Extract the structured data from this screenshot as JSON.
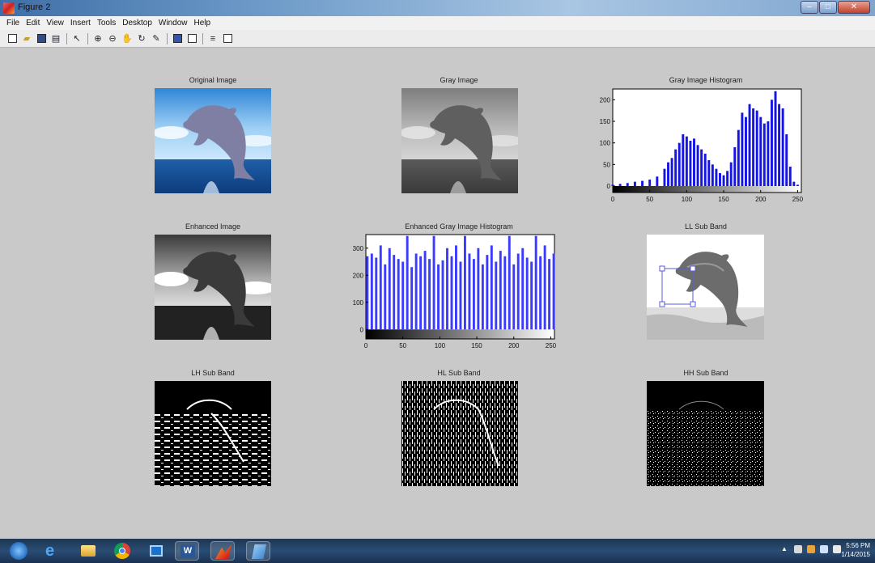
{
  "window": {
    "title": "Figure 2"
  },
  "menu": [
    "File",
    "Edit",
    "View",
    "Insert",
    "Tools",
    "Desktop",
    "Window",
    "Help"
  ],
  "toolbar_icons": [
    "new-figure-icon",
    "open-file-icon",
    "save-icon",
    "print-icon",
    "pointer-icon",
    "zoom-in-icon",
    "zoom-out-icon",
    "pan-icon",
    "rotate-icon",
    "data-cursor-icon",
    "colorbar-icon",
    "legend-icon",
    "hide-plot-tools-icon",
    "show-plot-tools-icon"
  ],
  "panels": {
    "original": "Original Image",
    "gray": "Gray Image",
    "gray_hist": "Gray Image Histogram",
    "enhanced": "Enhanced Image",
    "enh_hist": "Enhanced Gray Image Histogram",
    "ll": "LL Sub Band",
    "lh": "LH Sub Band",
    "hl": "HL Sub Band",
    "hh": "HH Sub Band"
  },
  "chart_data": [
    {
      "type": "bar",
      "title": "Gray Image Histogram",
      "x_ticks": [
        0,
        50,
        100,
        150,
        200,
        250
      ],
      "y_ticks": [
        0,
        50,
        100,
        150,
        200
      ],
      "xlim": [
        0,
        255
      ],
      "ylim": [
        -15,
        225
      ],
      "bar_color": "#1414e6",
      "x": [
        0,
        10,
        20,
        30,
        40,
        50,
        60,
        70,
        75,
        80,
        85,
        90,
        95,
        100,
        105,
        110,
        115,
        120,
        125,
        130,
        135,
        140,
        145,
        150,
        155,
        160,
        165,
        170,
        175,
        180,
        185,
        190,
        195,
        200,
        205,
        210,
        215,
        220,
        225,
        230,
        235,
        240,
        245,
        250
      ],
      "values": [
        3,
        5,
        7,
        10,
        12,
        15,
        22,
        40,
        55,
        65,
        85,
        100,
        120,
        115,
        105,
        110,
        95,
        85,
        75,
        60,
        50,
        40,
        30,
        25,
        35,
        55,
        90,
        130,
        170,
        160,
        190,
        180,
        175,
        160,
        145,
        150,
        200,
        220,
        190,
        180,
        120,
        45,
        10,
        3
      ]
    },
    {
      "type": "bar",
      "title": "Enhanced Gray Image Histogram",
      "x_ticks": [
        0,
        50,
        100,
        150,
        200,
        250
      ],
      "y_ticks": [
        0,
        100,
        200,
        300
      ],
      "xlim": [
        0,
        255
      ],
      "ylim": [
        -35,
        350
      ],
      "bar_color": "#3b3bff",
      "x": [
        2,
        8,
        14,
        20,
        26,
        32,
        38,
        44,
        50,
        56,
        62,
        68,
        74,
        80,
        86,
        92,
        98,
        104,
        110,
        116,
        122,
        128,
        134,
        140,
        146,
        152,
        158,
        164,
        170,
        176,
        182,
        188,
        194,
        200,
        206,
        212,
        218,
        224,
        230,
        236,
        242,
        248,
        254
      ],
      "values": [
        270,
        280,
        265,
        310,
        240,
        300,
        275,
        260,
        250,
        345,
        230,
        280,
        270,
        290,
        260,
        345,
        240,
        255,
        300,
        270,
        310,
        250,
        345,
        280,
        260,
        300,
        240,
        275,
        310,
        250,
        290,
        270,
        345,
        240,
        280,
        300,
        265,
        250,
        345,
        270,
        310,
        260,
        280
      ]
    }
  ],
  "taskbar": {
    "time": "5:56 PM",
    "date": "1/14/2015",
    "apps": [
      "start-button",
      "ie-icon",
      "explorer-icon",
      "chrome-icon",
      "media-icon",
      "word-icon",
      "matlab-icon",
      "app-icon"
    ]
  }
}
